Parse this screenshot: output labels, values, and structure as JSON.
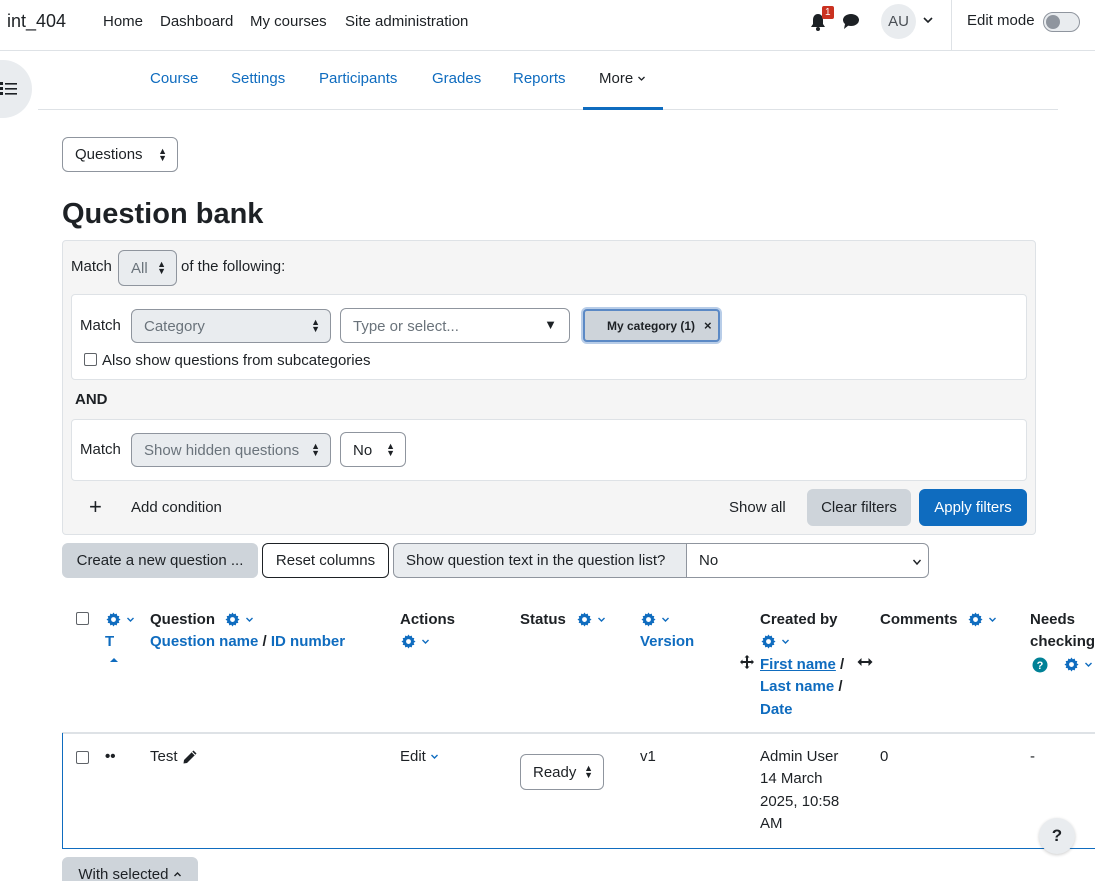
{
  "navbar": {
    "site_name": "int_404",
    "links": [
      "Home",
      "Dashboard",
      "My courses",
      "Site administration"
    ],
    "notification_count": "1",
    "user_initials": "AU",
    "edit_mode_label": "Edit mode",
    "edit_mode_on": false
  },
  "secondary_nav": {
    "items": [
      "Course",
      "Settings",
      "Participants",
      "Grades",
      "Reports",
      "More"
    ],
    "active": "More"
  },
  "bank_select": {
    "value": "Questions"
  },
  "page_title": "Question bank",
  "filters": {
    "match_prefix": "Match",
    "match_value": "All",
    "match_suffix": "of the following:",
    "condition1": {
      "match_label": "Match",
      "field": "Category",
      "search_placeholder": "Type or select...",
      "chip_label": "My category (1)",
      "chip_remove": "×",
      "subcategories_label": "Also show questions from subcategories",
      "subcategories_checked": false
    },
    "joiner": "AND",
    "condition2": {
      "match_label": "Match",
      "field": "Show hidden questions",
      "value": "No"
    },
    "add_condition_icon": "+",
    "add_condition_label": "Add condition",
    "show_all_label": "Show all",
    "clear_filters_label": "Clear filters",
    "apply_filters_label": "Apply filters"
  },
  "toolbar": {
    "create_label": "Create a new question ...",
    "reset_columns_label": "Reset columns",
    "show_text_label": "Show question text in the question list?",
    "show_text_value": "No"
  },
  "table": {
    "headers": {
      "type_sort": "T",
      "question": "Question",
      "question_name": "Question name",
      "separator": "/",
      "id_number": "ID number",
      "actions": "Actions",
      "status": "Status",
      "version": "Version",
      "created_by": "Created by",
      "first_name": "First name",
      "last_name": "Last name",
      "date": "Date",
      "comments": "Comments",
      "needs_checking_1": "Needs",
      "needs_checking_2": "checking"
    },
    "rows": [
      {
        "type_icon": "••",
        "name": "Test",
        "action": "Edit",
        "status": "Ready",
        "version": "v1",
        "created_by_name": "Admin User",
        "created_date_1": "14 March",
        "created_date_2": "2025, 10:58",
        "created_date_3": "AM",
        "comments": "0",
        "needs_checking": "-"
      }
    ]
  },
  "bulk": {
    "with_selected_label": "With selected"
  },
  "help": {
    "label": "?"
  },
  "colors": {
    "link": "#0f6cbf",
    "grey_button": "#ced4da",
    "badge": "#ca3120"
  }
}
